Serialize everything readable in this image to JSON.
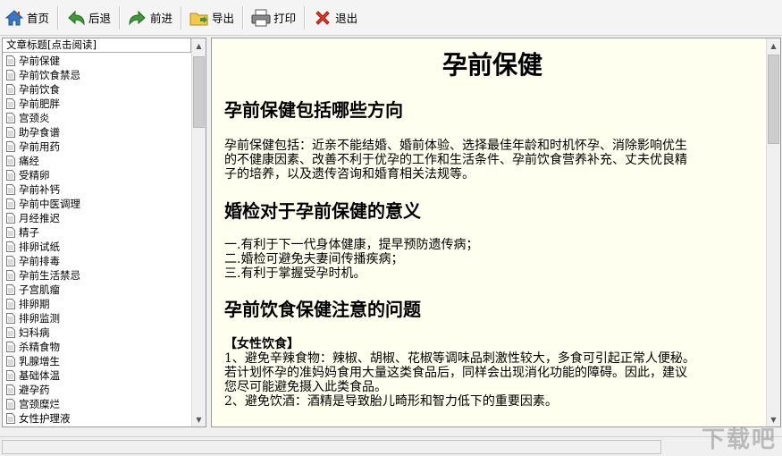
{
  "toolbar": {
    "home": "首页",
    "back": "后退",
    "forward": "前进",
    "export": "导出",
    "print": "打印",
    "exit": "退出"
  },
  "sidebar": {
    "header": "文章标题[点击阅读]",
    "items": [
      "孕前保健",
      "孕前饮食禁忌",
      "孕前饮食",
      "孕前肥胖",
      "宫颈炎",
      "助孕食谱",
      "孕前用药",
      "痛经",
      "受精卵",
      "孕前补钙",
      "孕前中医调理",
      "月经推迟",
      "精子",
      "排卵试纸",
      "孕前排毒",
      "孕前生活禁忌",
      "子宫肌瘤",
      "排卵期",
      "排卵监测",
      "妇科病",
      "杀精食物",
      "乳腺增生",
      "基础体温",
      "避孕药",
      "宫颈糜烂",
      "女性护理液"
    ]
  },
  "content": {
    "title": "孕前保健",
    "section1": {
      "heading": "孕前保健包括哪些方向",
      "lines": [
        "孕前保健包括：近亲不能结婚、婚前体验、选择最佳年龄和时机怀孕、消除影响优生",
        "的不健康因素、改善不利于优孕的工作和生活条件、孕前饮食营养补充、丈夫优良精",
        "子的培养，以及遗传咨询和婚育相关法规等。"
      ]
    },
    "section2": {
      "heading": "婚检对于孕前保健的意义",
      "lines": [
        "一.有利于下一代身体健康，提早预防遗传病；",
        "二.婚检可避免夫妻间传播疾病；",
        "三.有利于掌握受孕时机。"
      ]
    },
    "section3": {
      "heading": "孕前饮食保健注意的问题",
      "subheading": "【女性饮食】",
      "lines": [
        "1、避免辛辣食物：辣椒、胡椒、花椒等调味品刺激性较大，多食可引起正常人便秘。",
        "若计划怀孕的准妈妈食用大量这类食品后，同样会出现消化功能的障碍。因此，建议",
        "您尽可能避免摄入此类食品。",
        "2、避免饮酒：酒精是导致胎儿畸形和智力低下的重要因素。"
      ]
    }
  },
  "watermark": "下载吧"
}
